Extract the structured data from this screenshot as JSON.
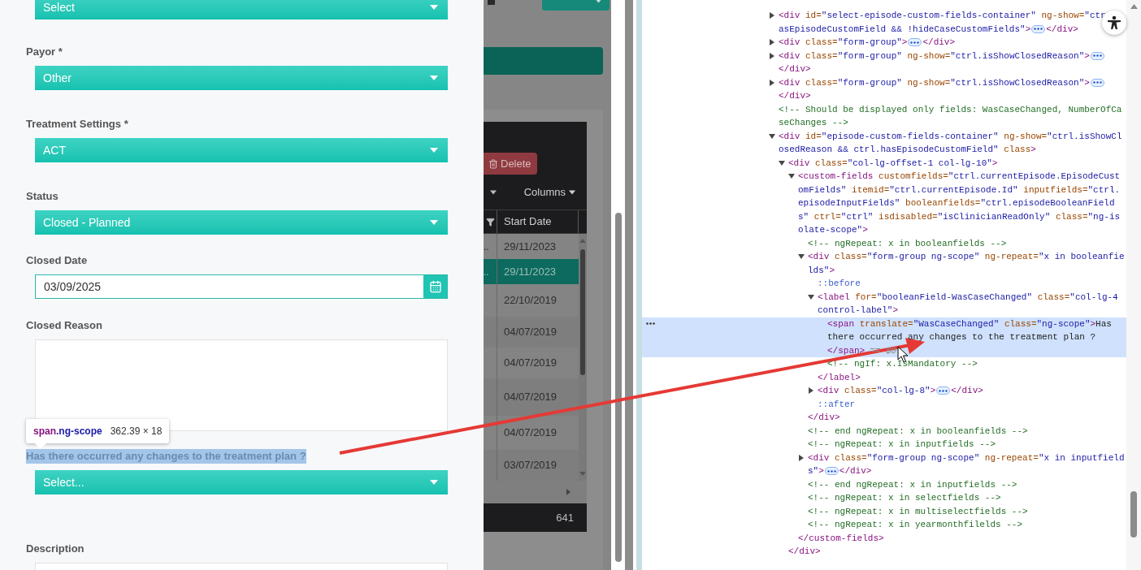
{
  "form": {
    "fields": [
      {
        "kind": "select",
        "value": "Select"
      },
      {
        "kind": "select",
        "label": "Payor *",
        "value": "Other"
      },
      {
        "kind": "select",
        "label": "Treatment Settings *",
        "value": "ACT"
      },
      {
        "kind": "select",
        "label": "Status",
        "value": "Closed - Planned"
      },
      {
        "kind": "date",
        "label": "Closed Date",
        "value": "03/09/2025"
      },
      {
        "kind": "textarea",
        "label": "Closed Reason"
      },
      {
        "kind": "select",
        "label": "Has there occurred any changes to the treatment plan ?",
        "label_highlighted": true,
        "value": "Select..."
      },
      {
        "kind": "textarea",
        "label": "Description"
      }
    ]
  },
  "inspect_tooltip": {
    "tag": "span",
    "class": ".ng-scope",
    "size": "362.39 × 18"
  },
  "background_app": {
    "delete": "Delete",
    "columns": "Columns",
    "column": "Start Date",
    "rows": [
      {
        "cell_1": "..",
        "date": "29/11/2023",
        "selected": false
      },
      {
        "cell_1": "..",
        "date": "29/11/2023",
        "selected": true
      },
      {
        "date": "22/10/2019",
        "selected": false
      },
      {
        "date": "04/07/2019",
        "selected": false
      },
      {
        "date": "04/07/2019",
        "selected": false
      },
      {
        "date": "04/07/2019",
        "selected": false
      },
      {
        "date": "04/07/2019",
        "selected": false
      },
      {
        "date": "03/07/2019",
        "selected": false
      }
    ],
    "total": "641"
  },
  "devtools": {
    "elements": [
      {
        "kind": "element",
        "expanded": false,
        "selected": false,
        "lines": [
          "<div id=\"select-episode-custom-fields-container\" ng-show=\"ctr",
          "asEpisodeCustomField && !hideCaseCustomFields\">"
        ],
        "close": "</div>"
      },
      {
        "kind": "element",
        "expanded": false,
        "selected": false,
        "lines": [
          "<div class=\"form-group\">"
        ],
        "close": "</div>"
      },
      {
        "kind": "element",
        "expanded": false,
        "selected": false,
        "lines": [
          "<div class=\"form-group\" ng-show=\"ctrl.isShowClosedReason\">"
        ],
        "close": "</div>",
        "close_wrapped": true
      },
      {
        "kind": "element",
        "expanded": false,
        "selected": false,
        "lines": [
          "<div class=\"form-group\" ng-show=\"ctrl.isShowClosedReason\">"
        ],
        "close": "</div>",
        "close_wrapped": true
      },
      {
        "kind": "comment",
        "selected": false,
        "lines": [
          "<!-- Should be displayed only fields: WasCaseChanged, NumberOfCa",
          "seChanges -->"
        ]
      },
      {
        "kind": "element",
        "expanded": true,
        "selected": false,
        "lines": [
          "<div id=\"episode-custom-fields-container\" ng-show=\"ctrl.isShowCl",
          "osedReason && ctrl.hasEpisodeCustomField\" class>"
        ],
        "children": [
          {
            "kind": "element",
            "expanded": true,
            "selected": false,
            "lines": [
              "<div class=\"col-lg-offset-1 col-lg-10\">"
            ],
            "close": "</div>",
            "children": [
              {
                "kind": "element",
                "expanded": true,
                "selected": false,
                "lines": [
                  "<custom-fields customfields=\"ctrl.currentEpisode.EpisodeCust",
                  "omFields\" itemid=\"ctrl.currentEpisode.Id\" inputfields=\"ctrl.",
                  "episodeInputFields\" booleanfields=\"ctrl.episodeBooleanField",
                  "s\" ctrl=\"ctrl\" isdisabled=\"isClinicianReadOnly\" class=\"ng-is",
                  "olate-scope\">"
                ],
                "close": "</custom-fields>",
                "children": [
                  {
                    "kind": "comment",
                    "selected": false,
                    "lines": [
                      "<!-- ngRepeat: x in booleanfields -->"
                    ]
                  },
                  {
                    "kind": "element",
                    "expanded": true,
                    "selected": false,
                    "lines": [
                      "<div class=\"form-group ng-scope\" ng-repeat=\"x in booleanfie",
                      "lds\">"
                    ],
                    "close": "</div>",
                    "children": [
                      {
                        "kind": "pseudo",
                        "selected": false,
                        "lines": [
                          "::before"
                        ]
                      },
                      {
                        "kind": "element",
                        "expanded": true,
                        "selected": false,
                        "lines": [
                          "<label for=\"booleanField-WasCaseChanged\" class=\"col-lg-4",
                          "control-label\">"
                        ],
                        "close": "</label>",
                        "children": [
                          {
                            "kind": "element",
                            "selected": true,
                            "lines": [
                              "<span translate=\"WasCaseChanged\" class=\"ng-scope\">Has",
                              "there occurred any changes to the treatment plan ?",
                              "</span>"
                            ],
                            "ref": "== $0"
                          },
                          {
                            "kind": "comment",
                            "selected": false,
                            "lines": [
                              "<!-- ngIf: x.IsMandatory -->"
                            ]
                          }
                        ]
                      },
                      {
                        "kind": "element",
                        "expanded": false,
                        "selected": false,
                        "lines": [
                          "<div class=\"col-lg-8\">"
                        ],
                        "close": "</div>"
                      },
                      {
                        "kind": "pseudo",
                        "selected": false,
                        "lines": [
                          "::after"
                        ]
                      }
                    ]
                  },
                  {
                    "kind": "comment",
                    "selected": false,
                    "lines": [
                      "<!-- end ngRepeat: x in booleanfields -->"
                    ]
                  },
                  {
                    "kind": "comment",
                    "selected": false,
                    "lines": [
                      "<!-- ngRepeat: x in inputfields -->"
                    ]
                  },
                  {
                    "kind": "element",
                    "expanded": false,
                    "selected": false,
                    "lines": [
                      "<div class=\"form-group ng-scope\" ng-repeat=\"x in inputfield",
                      "s\">"
                    ],
                    "close": "</div>"
                  },
                  {
                    "kind": "comment",
                    "selected": false,
                    "lines": [
                      "<!-- end ngRepeat: x in inputfields -->"
                    ]
                  },
                  {
                    "kind": "comment",
                    "selected": false,
                    "lines": [
                      "<!-- ngRepeat: x in selectfields -->"
                    ]
                  },
                  {
                    "kind": "comment",
                    "selected": false,
                    "lines": [
                      "<!-- ngRepeat: x in multiselectfields -->"
                    ]
                  },
                  {
                    "kind": "comment",
                    "selected": false,
                    "lines": [
                      "<!-- ngRepeat: x in yearmonthfilelds -->"
                    ]
                  }
                ]
              }
            ]
          }
        ]
      }
    ]
  }
}
